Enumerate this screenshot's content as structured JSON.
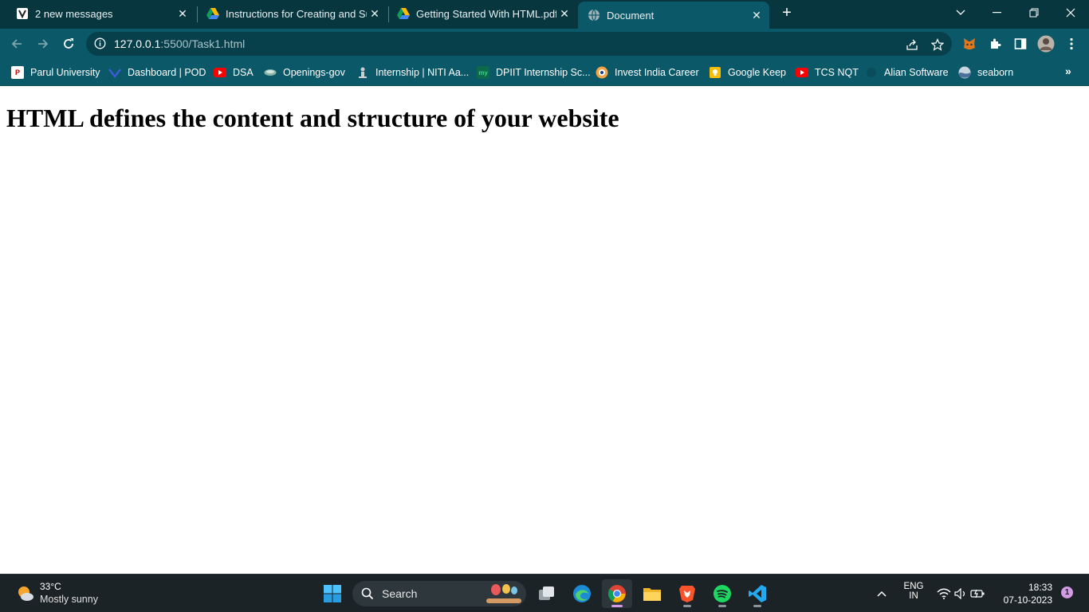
{
  "tabs": [
    {
      "title": "2 new messages",
      "icon": "gmail-like-icon",
      "active": false
    },
    {
      "title": "Instructions for Creating and Sub",
      "icon": "google-drive-icon",
      "active": false
    },
    {
      "title": "Getting Started With HTML.pdf -",
      "icon": "google-drive-icon",
      "active": false
    },
    {
      "title": "Document",
      "icon": "globe-icon",
      "active": true
    }
  ],
  "address_bar": {
    "host": "127.0.0.1",
    "path": ":5500/Task1.html"
  },
  "bookmarks": [
    {
      "label": "Parul University",
      "icon": "parul-icon"
    },
    {
      "label": "Dashboard | POD",
      "icon": "pod-icon"
    },
    {
      "label": "DSA",
      "icon": "youtube-icon"
    },
    {
      "label": "Openings-gov",
      "icon": "gov-icon"
    },
    {
      "label": "Internship | NITI Aa...",
      "icon": "niti-icon"
    },
    {
      "label": "DPIIT Internship Sc...",
      "icon": "mygov-icon"
    },
    {
      "label": "Invest India Career",
      "icon": "invest-india-icon"
    },
    {
      "label": "Google Keep",
      "icon": "google-keep-icon"
    },
    {
      "label": "TCS NQT",
      "icon": "youtube-icon"
    },
    {
      "label": "Alian Software",
      "icon": "alian-icon"
    },
    {
      "label": "seaborn",
      "icon": "seaborn-icon"
    }
  ],
  "page": {
    "heading": "HTML defines the content and structure of your website"
  },
  "taskbar": {
    "weather_temp": "33°C",
    "weather_condition": "Mostly sunny",
    "search_placeholder": "Search",
    "language_top": "ENG",
    "language_bottom": "IN",
    "time": "18:33",
    "date": "07-10-2023",
    "notification_count": "1"
  },
  "colors": {
    "tab_strip": "#08363f",
    "toolbar": "#0b5868",
    "taskbar": "#1c2327"
  }
}
